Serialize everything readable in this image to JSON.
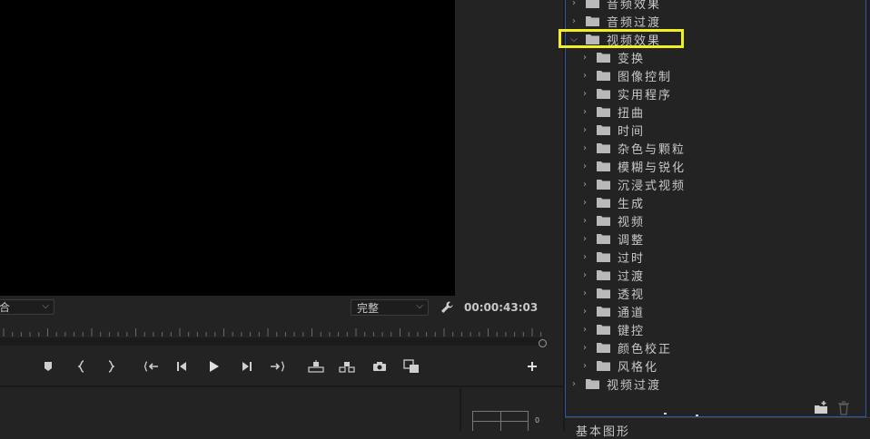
{
  "monitor": {
    "fit_label": "合",
    "quality_label": "完整",
    "timecode": "00:00:43:03"
  },
  "effects": {
    "top_items": [
      {
        "label": "音频效果",
        "expanded": false
      },
      {
        "label": "音频过渡",
        "expanded": false
      },
      {
        "label": "视频效果",
        "expanded": true,
        "highlighted": true
      }
    ],
    "video_effect_children": [
      "变换",
      "图像控制",
      "实用程序",
      "扭曲",
      "时间",
      "杂色与颗粒",
      "模糊与锐化",
      "沉浸式视频",
      "生成",
      "视频",
      "调整",
      "过时",
      "过渡",
      "透视",
      "通道",
      "键控",
      "颜色校正",
      "风格化"
    ],
    "bottom_item": {
      "label": "视频过渡",
      "expanded": false
    }
  },
  "bottom_tab": {
    "label": "基本图形"
  },
  "colors": {
    "highlight": "#f2f021",
    "panel_border": "#2d59a6",
    "background": "#232323"
  },
  "icons": [
    "wrench-icon",
    "marker-icon",
    "mark-in-icon",
    "mark-out-icon",
    "go-to-in-icon",
    "step-back-icon",
    "play-icon",
    "step-forward-icon",
    "go-to-out-icon",
    "lift-icon",
    "extract-icon",
    "camera-icon",
    "compare-icon",
    "add-icon",
    "new-bin-icon",
    "trash-icon"
  ]
}
